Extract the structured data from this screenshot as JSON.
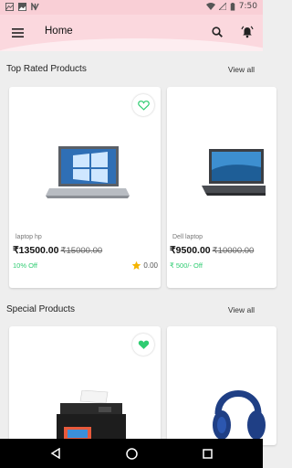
{
  "status_bar": {
    "time": "7:50"
  },
  "app_bar": {
    "title": "Home"
  },
  "colors": {
    "accent": "#2ecc71",
    "star": "#f5b400",
    "app_bar_bg": "#fbd8de"
  },
  "sections": [
    {
      "title": "Top Rated Products",
      "view_all": "View all",
      "products": [
        {
          "name": "laptop hp",
          "price": "₹13500.00",
          "old_price": "₹15000.00",
          "discount": "10% Off",
          "rating": "0.00",
          "favorite": false
        },
        {
          "name": "Dell laptop",
          "price": "₹9500.00",
          "old_price": "₹10000.00",
          "discount": "₹ 500/- Off",
          "favorite": false
        }
      ]
    },
    {
      "title": "Special Products",
      "view_all": "View all",
      "products": [
        {
          "favorite": true
        },
        {}
      ]
    }
  ]
}
